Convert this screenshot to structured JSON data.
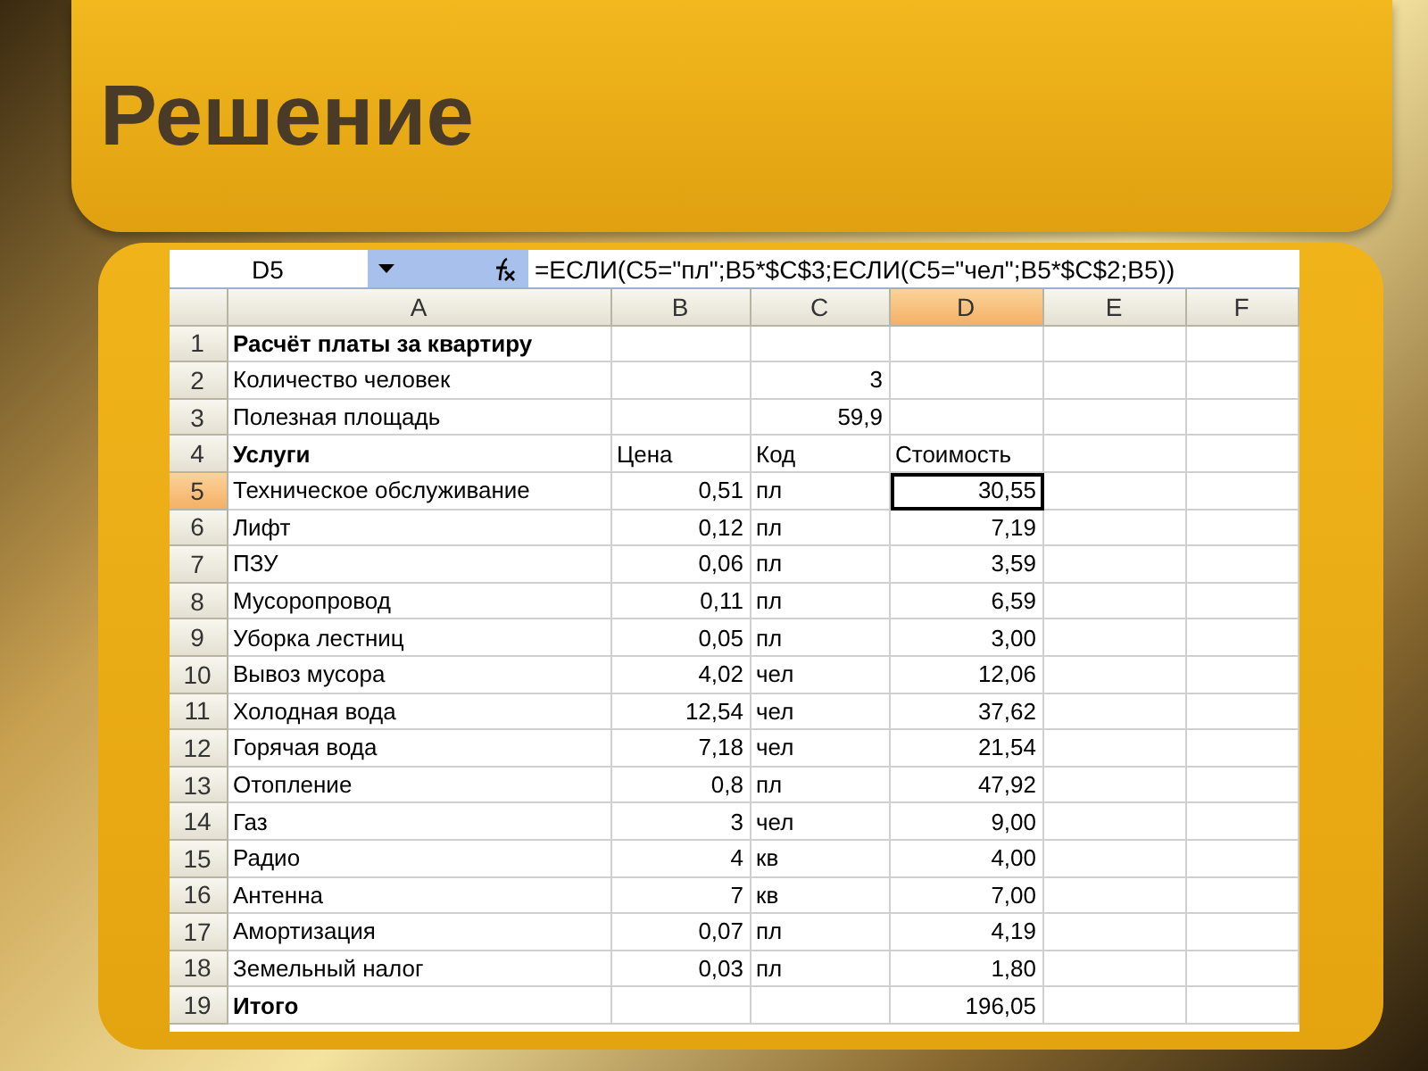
{
  "slide": {
    "title": "Решение"
  },
  "sheet": {
    "name_box": "D5",
    "formula": "=ЕСЛИ(C5=\"пл\";B5*$C$3;ЕСЛИ(C5=\"чел\";B5*$C$2;B5))",
    "columns": [
      {
        "label": "A",
        "selected": false
      },
      {
        "label": "B",
        "selected": false
      },
      {
        "label": "C",
        "selected": false
      },
      {
        "label": "D",
        "selected": true
      },
      {
        "label": "E",
        "selected": false
      },
      {
        "label": "F",
        "selected": false
      }
    ],
    "rows": [
      {
        "number": "1",
        "kind": "title",
        "selected": false,
        "a": "Расчёт платы за квартиру"
      },
      {
        "number": "2",
        "kind": "input",
        "selected": false,
        "a": "Количество человек",
        "c": "3"
      },
      {
        "number": "3",
        "kind": "input",
        "selected": false,
        "a": "Полезная площадь",
        "c": "59,9"
      },
      {
        "number": "4",
        "kind": "header",
        "selected": false,
        "a": "Услуги",
        "b": "Цена",
        "c": "Код",
        "d": "Стоимость"
      },
      {
        "number": "5",
        "kind": "item",
        "selected": true,
        "a": "Техническое обслуживание",
        "b": "0,51",
        "c": "пл",
        "d": "30,55"
      },
      {
        "number": "6",
        "kind": "item",
        "selected": false,
        "a": "Лифт",
        "b": "0,12",
        "c": "пл",
        "d": "7,19"
      },
      {
        "number": "7",
        "kind": "item",
        "selected": false,
        "a": "ПЗУ",
        "b": "0,06",
        "c": "пл",
        "d": "3,59"
      },
      {
        "number": "8",
        "kind": "item",
        "selected": false,
        "a": "Мусоропровод",
        "b": "0,11",
        "c": "пл",
        "d": "6,59"
      },
      {
        "number": "9",
        "kind": "item",
        "selected": false,
        "a": "Уборка лестниц",
        "b": "0,05",
        "c": "пл",
        "d": "3,00"
      },
      {
        "number": "10",
        "kind": "item",
        "selected": false,
        "a": "Вывоз мусора",
        "b": "4,02",
        "c": "чел",
        "d": "12,06"
      },
      {
        "number": "11",
        "kind": "item",
        "selected": false,
        "a": "Холодная вода",
        "b": "12,54",
        "c": "чел",
        "d": "37,62"
      },
      {
        "number": "12",
        "kind": "item",
        "selected": false,
        "a": "Горячая вода",
        "b": "7,18",
        "c": "чел",
        "d": "21,54"
      },
      {
        "number": "13",
        "kind": "item",
        "selected": false,
        "a": "Отопление",
        "b": "0,8",
        "c": "пл",
        "d": "47,92"
      },
      {
        "number": "14",
        "kind": "item",
        "selected": false,
        "a": "Газ",
        "b": "3",
        "c": "чел",
        "d": "9,00"
      },
      {
        "number": "15",
        "kind": "item",
        "selected": false,
        "a": "Радио",
        "b": "4",
        "c": "кв",
        "d": "4,00"
      },
      {
        "number": "16",
        "kind": "item",
        "selected": false,
        "a": "Антенна",
        "b": "7",
        "c": "кв",
        "d": "7,00"
      },
      {
        "number": "17",
        "kind": "item",
        "selected": false,
        "a": "Амортизация",
        "b": "0,07",
        "c": "пл",
        "d": "4,19"
      },
      {
        "number": "18",
        "kind": "item",
        "selected": false,
        "a": "Земельный налог",
        "b": "0,03",
        "c": "пл",
        "d": "1,80"
      },
      {
        "number": "19",
        "kind": "total",
        "selected": false,
        "a": "Итого",
        "d": "196,05"
      }
    ]
  }
}
